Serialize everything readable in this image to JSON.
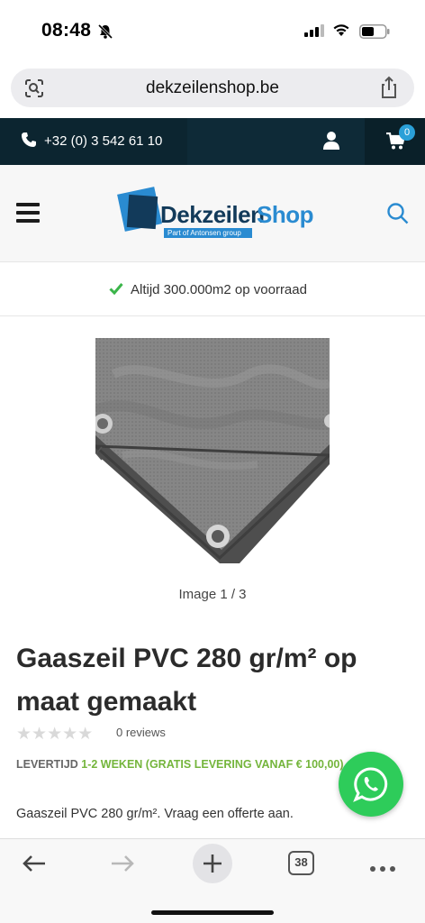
{
  "status_bar": {
    "time": "08:48",
    "icons": [
      "bell-slash-icon",
      "signal-icon",
      "wifi-icon",
      "battery-icon"
    ]
  },
  "address_bar": {
    "url": "dekzeilenshop.be",
    "icons": [
      "visual-lookup-icon",
      "share-icon"
    ]
  },
  "top_bar": {
    "phone": "+32 (0) 3 542 61 10",
    "cart_count": "0",
    "icons": [
      "phone-icon",
      "user-icon",
      "cart-icon"
    ]
  },
  "header": {
    "logo": {
      "part1": "Dekzeilen",
      "part2": "Shop",
      "tagline": "Part of Antonsen group"
    },
    "icons": [
      "menu-icon",
      "search-icon"
    ]
  },
  "stock_notice": {
    "text": "Altijd 300.000m2 op voorraad"
  },
  "gallery": {
    "counter": "Image 1 / 3",
    "icons": [
      "chevron-left-icon"
    ]
  },
  "product": {
    "title": "Gaaszeil PVC 280 gr/m² op maat gemaakt",
    "rating": 0,
    "reviews": "0 reviews",
    "leadtime_label": "LEVERTIJD",
    "leadtime_value": "1-2 WEKEN (GRATIS LEVERING VANAF € 100,00)",
    "description": "Gaaszeil PVC 280 gr/m². Vraag een offerte aan."
  },
  "whatsapp": {
    "icon": "whatsapp-icon"
  },
  "toolbar": {
    "tab_count": "38",
    "icons": [
      "back-arrow-icon",
      "forward-arrow-icon",
      "new-tab-icon",
      "tabs-icon",
      "more-icon"
    ]
  },
  "colors": {
    "top_bar": "#0e2a37",
    "accent_blue": "#2a8bd1",
    "leadtime_green": "#74b53c",
    "whatsapp_green": "#2ecc5a"
  }
}
